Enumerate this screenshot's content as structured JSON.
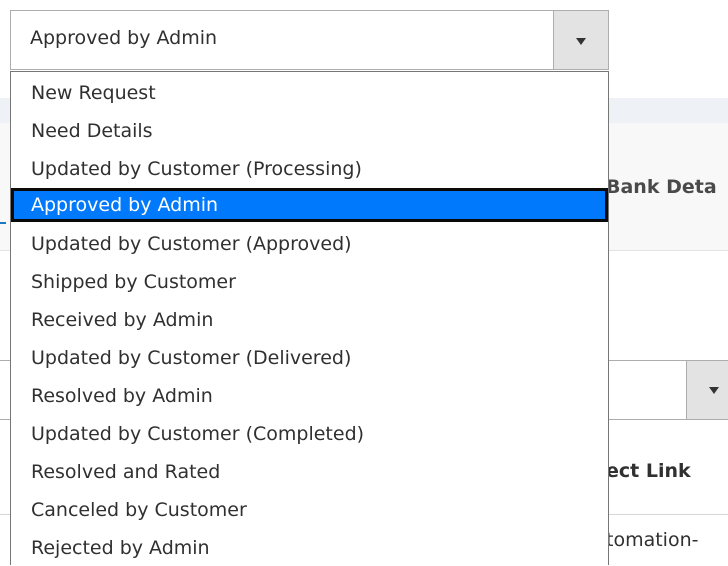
{
  "background": {
    "tab_label": "Bank Deta",
    "column_header": "ect Link",
    "row_text": "tomation-"
  },
  "select": {
    "value": "Approved by Admin"
  },
  "dropdown": {
    "options": [
      "New Request",
      "Need Details",
      "Updated by Customer (Processing)",
      "Approved by Admin",
      "Updated by Customer (Approved)",
      "Shipped by Customer",
      "Received by Admin",
      "Updated by Customer (Delivered)",
      "Resolved by Admin",
      "Updated by Customer (Completed)",
      "Resolved and Rated",
      "Canceled by Customer",
      "Rejected by Admin"
    ],
    "selected_index": 3
  },
  "colors": {
    "highlight": "#0079fd",
    "highlight_border": "#0a0a0a",
    "button_bg": "#e3e3e3"
  },
  "icons": {
    "select_arrow": "chevron-down-icon"
  }
}
